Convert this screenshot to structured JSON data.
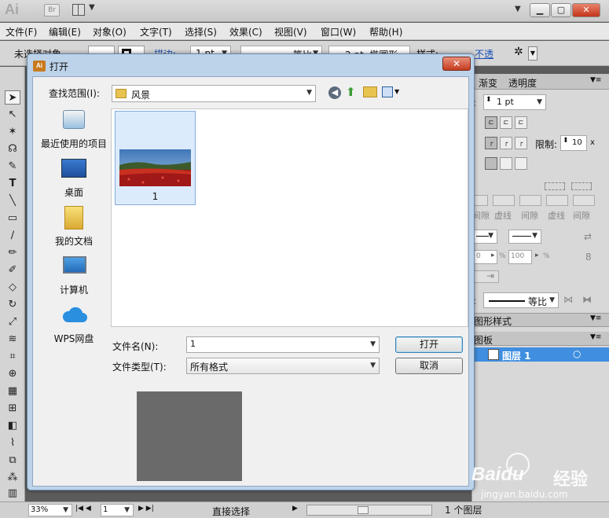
{
  "app": {
    "logo": "Ai",
    "bridge": "Br",
    "menus": [
      "文件(F)",
      "编辑(E)",
      "对象(O)",
      "文字(T)",
      "选择(S)",
      "效果(C)",
      "视图(V)",
      "窗口(W)",
      "帮助(H)"
    ],
    "control_bar": {
      "selection": "未选择对象",
      "stroke_label": "描边:",
      "stroke_weight": "1 pt",
      "profile": "等比",
      "brush": "2 pt. 椭圆形",
      "style_label": "样式:",
      "opacity_label": "不透"
    }
  },
  "right_panel": {
    "tabs": [
      "渐变",
      "透明度"
    ],
    "stroke_weight": "1 pt",
    "limit_label": "限制:",
    "limit_value": "10",
    "limit_unit": "x",
    "dash_labels": [
      "间隙",
      "虚线",
      "间隙",
      "虚线",
      "间隙"
    ],
    "scale_a": "0",
    "scale_b": "100",
    "percent": "%",
    "profile_label": "等比",
    "graphic_styles": "图形样式",
    "layers_tab": "图板",
    "layer_name": "图层 1",
    "layer_count": "1 个图层"
  },
  "status_bar": {
    "zoom": "33%",
    "page": "1",
    "tool": "直接选择"
  },
  "dialog": {
    "title": "打开",
    "look_in_label": "查找范围(I):",
    "look_in_value": "风景",
    "places": [
      "最近使用的项目",
      "桌面",
      "我的文档",
      "计算机",
      "WPS网盘"
    ],
    "file_item": "1",
    "filename_label": "文件名(N):",
    "filename_value": "1",
    "filetype_label": "文件类型(T):",
    "filetype_value": "所有格式",
    "open_button": "打开",
    "cancel_button": "取消"
  },
  "watermark": {
    "brand": "Baidu",
    "brand_cn": "经验",
    "url": "jingyan.baidu.com"
  }
}
